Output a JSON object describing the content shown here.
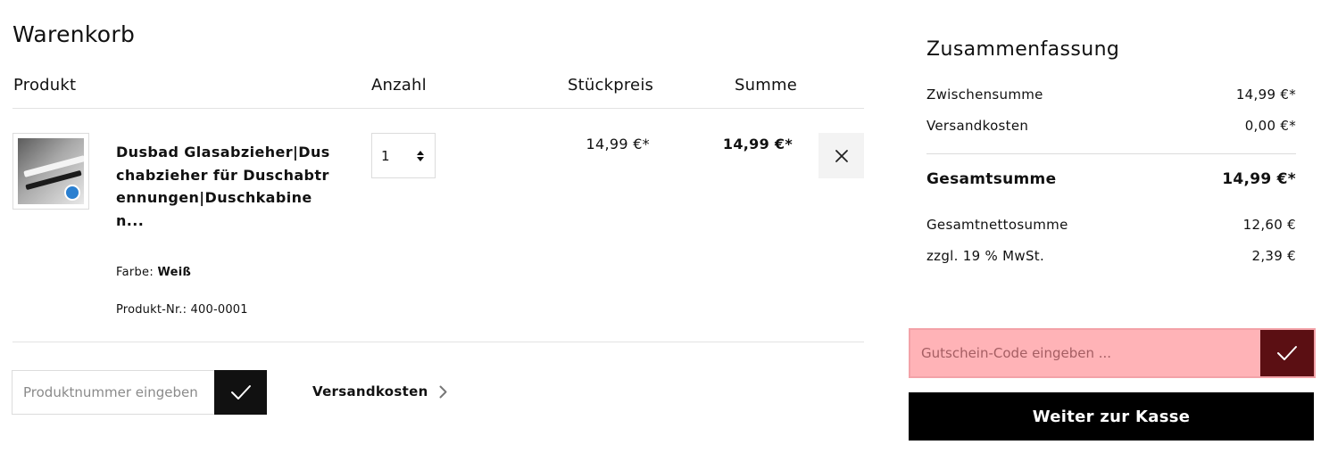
{
  "cart": {
    "title": "Warenkorb",
    "columns": {
      "product": "Produkt",
      "quantity": "Anzahl",
      "unit_price": "Stückpreis",
      "total": "Summe"
    },
    "items": [
      {
        "name": "Dusbad Glasabzieher|Duschabzieher für Duschabtrennungen|Duschkabinen...",
        "color_label": "Farbe:",
        "color_value": "Weiß",
        "sku": "Produkt-Nr.: 400-0001",
        "quantity": "1",
        "unit_price": "14,99 €*",
        "line_total": "14,99 €*"
      }
    ],
    "product_number_input": {
      "placeholder": "Produktnummer eingeben"
    },
    "shipping_link": "Versandkosten"
  },
  "summary": {
    "title": "Zusammenfassung",
    "subtotal_label": "Zwischensumme",
    "subtotal": "14,99 €*",
    "shipping_label": "Versandkosten",
    "shipping": "0,00 €*",
    "total_label": "Gesamtsumme",
    "total": "14,99 €*",
    "net_label": "Gesamtnettosumme",
    "net": "12,60 €",
    "vat_label": "zzgl. 19 % MwSt.",
    "vat": "2,39 €"
  },
  "voucher": {
    "placeholder": "Gutschein-Code eingeben ..."
  },
  "checkout": {
    "label": "Weiter zur Kasse"
  },
  "colors": {
    "accent_dark": "#5b0f13",
    "voucher_bg": "#ffb3b7",
    "primary": "#000000"
  },
  "icons": [
    "close-icon",
    "checkmark-icon",
    "chevron-right-icon",
    "sort-arrows-icon"
  ]
}
